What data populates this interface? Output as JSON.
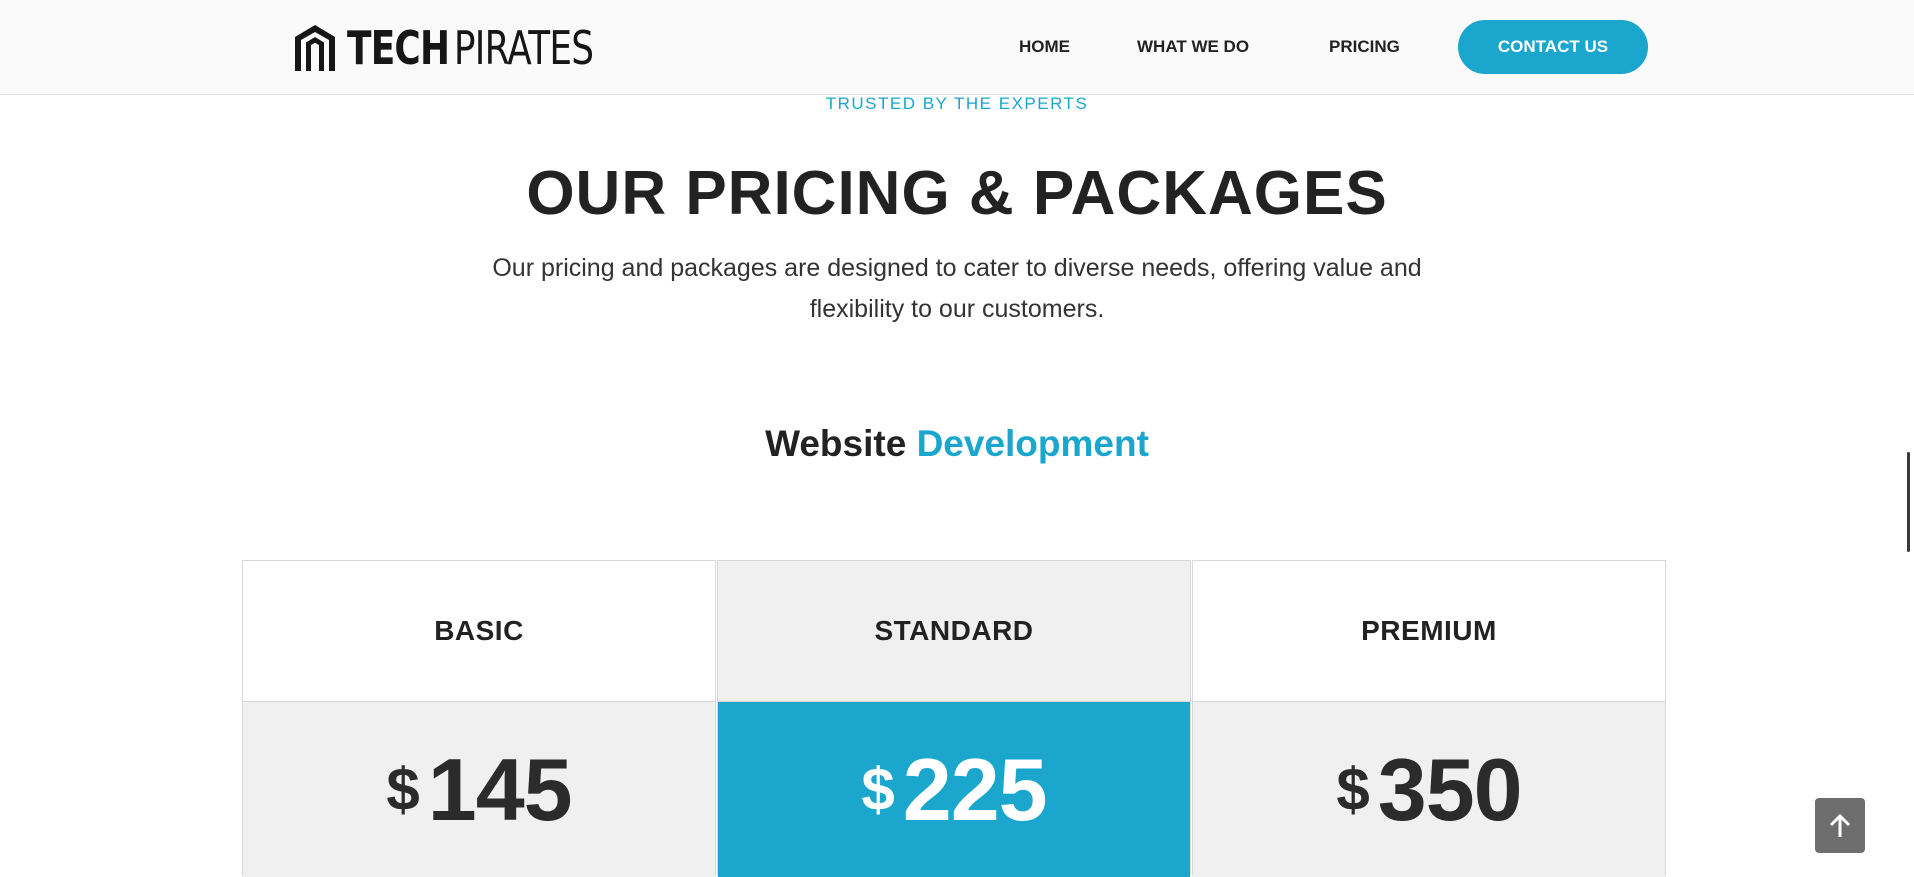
{
  "header": {
    "logo": {
      "icon": "shield-logo-icon",
      "text_bold": "TECH",
      "text_thin": "PIRATES"
    },
    "nav": [
      {
        "label": "HOME"
      },
      {
        "label": "WHAT WE DO"
      },
      {
        "label": "PRICING"
      }
    ],
    "contact_label": "CONTACT US"
  },
  "hero": {
    "eyebrow": "TRUSTED BY THE EXPERTS",
    "title": "OUR PRICING & PACKAGES",
    "intro": "Our pricing and packages are designed to cater to diverse needs, offering value and flexibility to our customers."
  },
  "section": {
    "title_plain": "Website",
    "title_accent": "Development"
  },
  "plans": [
    {
      "name": "BASIC",
      "currency": "$",
      "price": "145"
    },
    {
      "name": "STANDARD",
      "currency": "$",
      "price": "225"
    },
    {
      "name": "PREMIUM",
      "currency": "$",
      "price": "350"
    }
  ],
  "colors": {
    "accent": "#1aa6cd",
    "panel": "#f0f0f0",
    "text": "#222222"
  },
  "back_to_top": {
    "icon": "arrow-up-icon"
  }
}
